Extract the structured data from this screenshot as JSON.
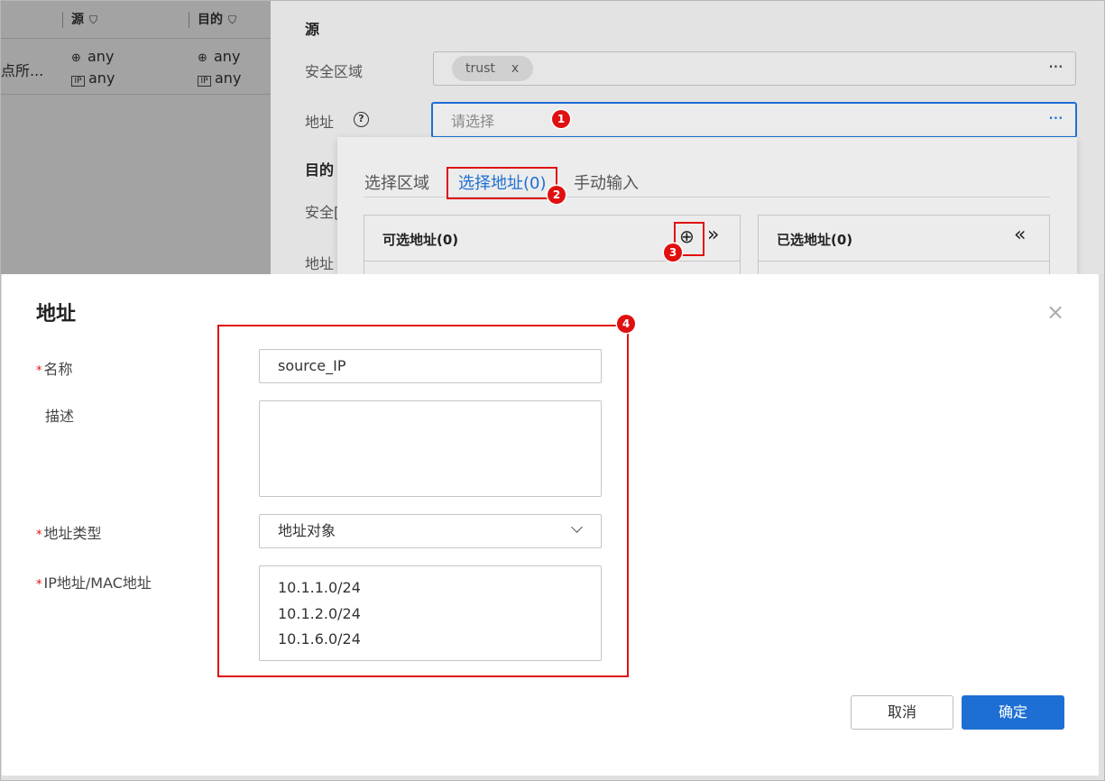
{
  "table": {
    "col_source": "源",
    "col_dest": "目的",
    "filter_icon": "filter-icon",
    "row_name_fragment": "点所...",
    "src_zone": "any",
    "src_ip": "any",
    "dst_zone": "any",
    "dst_ip": "any",
    "ip_icon_text": "IP"
  },
  "source_section": {
    "title": "源",
    "zone_label": "安全区域",
    "zone_tag": "trust",
    "zone_tag_remove": "x",
    "more": "···",
    "address_label": "地址",
    "help": "?",
    "address_placeholder": "请选择"
  },
  "dest_section": {
    "title": "目的",
    "zone_label_fragment": "安全[",
    "address_label": "地址"
  },
  "dropdown": {
    "tabs": [
      "选择区域",
      "选择地址(0)",
      "手动输入"
    ],
    "available_title": "可选地址(0)",
    "selected_title": "已选地址(0)",
    "add_icon": "⊕",
    "move_right": "»",
    "move_left": "«"
  },
  "badges": [
    "1",
    "2",
    "3",
    "4"
  ],
  "modal": {
    "title": "地址",
    "close": "×",
    "name_label": "名称",
    "name_value": "source_IP",
    "desc_label": "描述",
    "desc_value": "",
    "type_label": "地址类型",
    "type_value": "地址对象",
    "ip_label": "IP地址/MAC地址",
    "ip_values": [
      "10.1.1.0/24",
      "10.1.2.0/24",
      "10.1.6.0/24"
    ],
    "cancel": "取消",
    "ok": "确定",
    "required_mark": "*"
  },
  "colors": {
    "accent": "#1e6fd4",
    "annotation_red": "#e01010",
    "overlay_gray": "#a3a3a3"
  }
}
